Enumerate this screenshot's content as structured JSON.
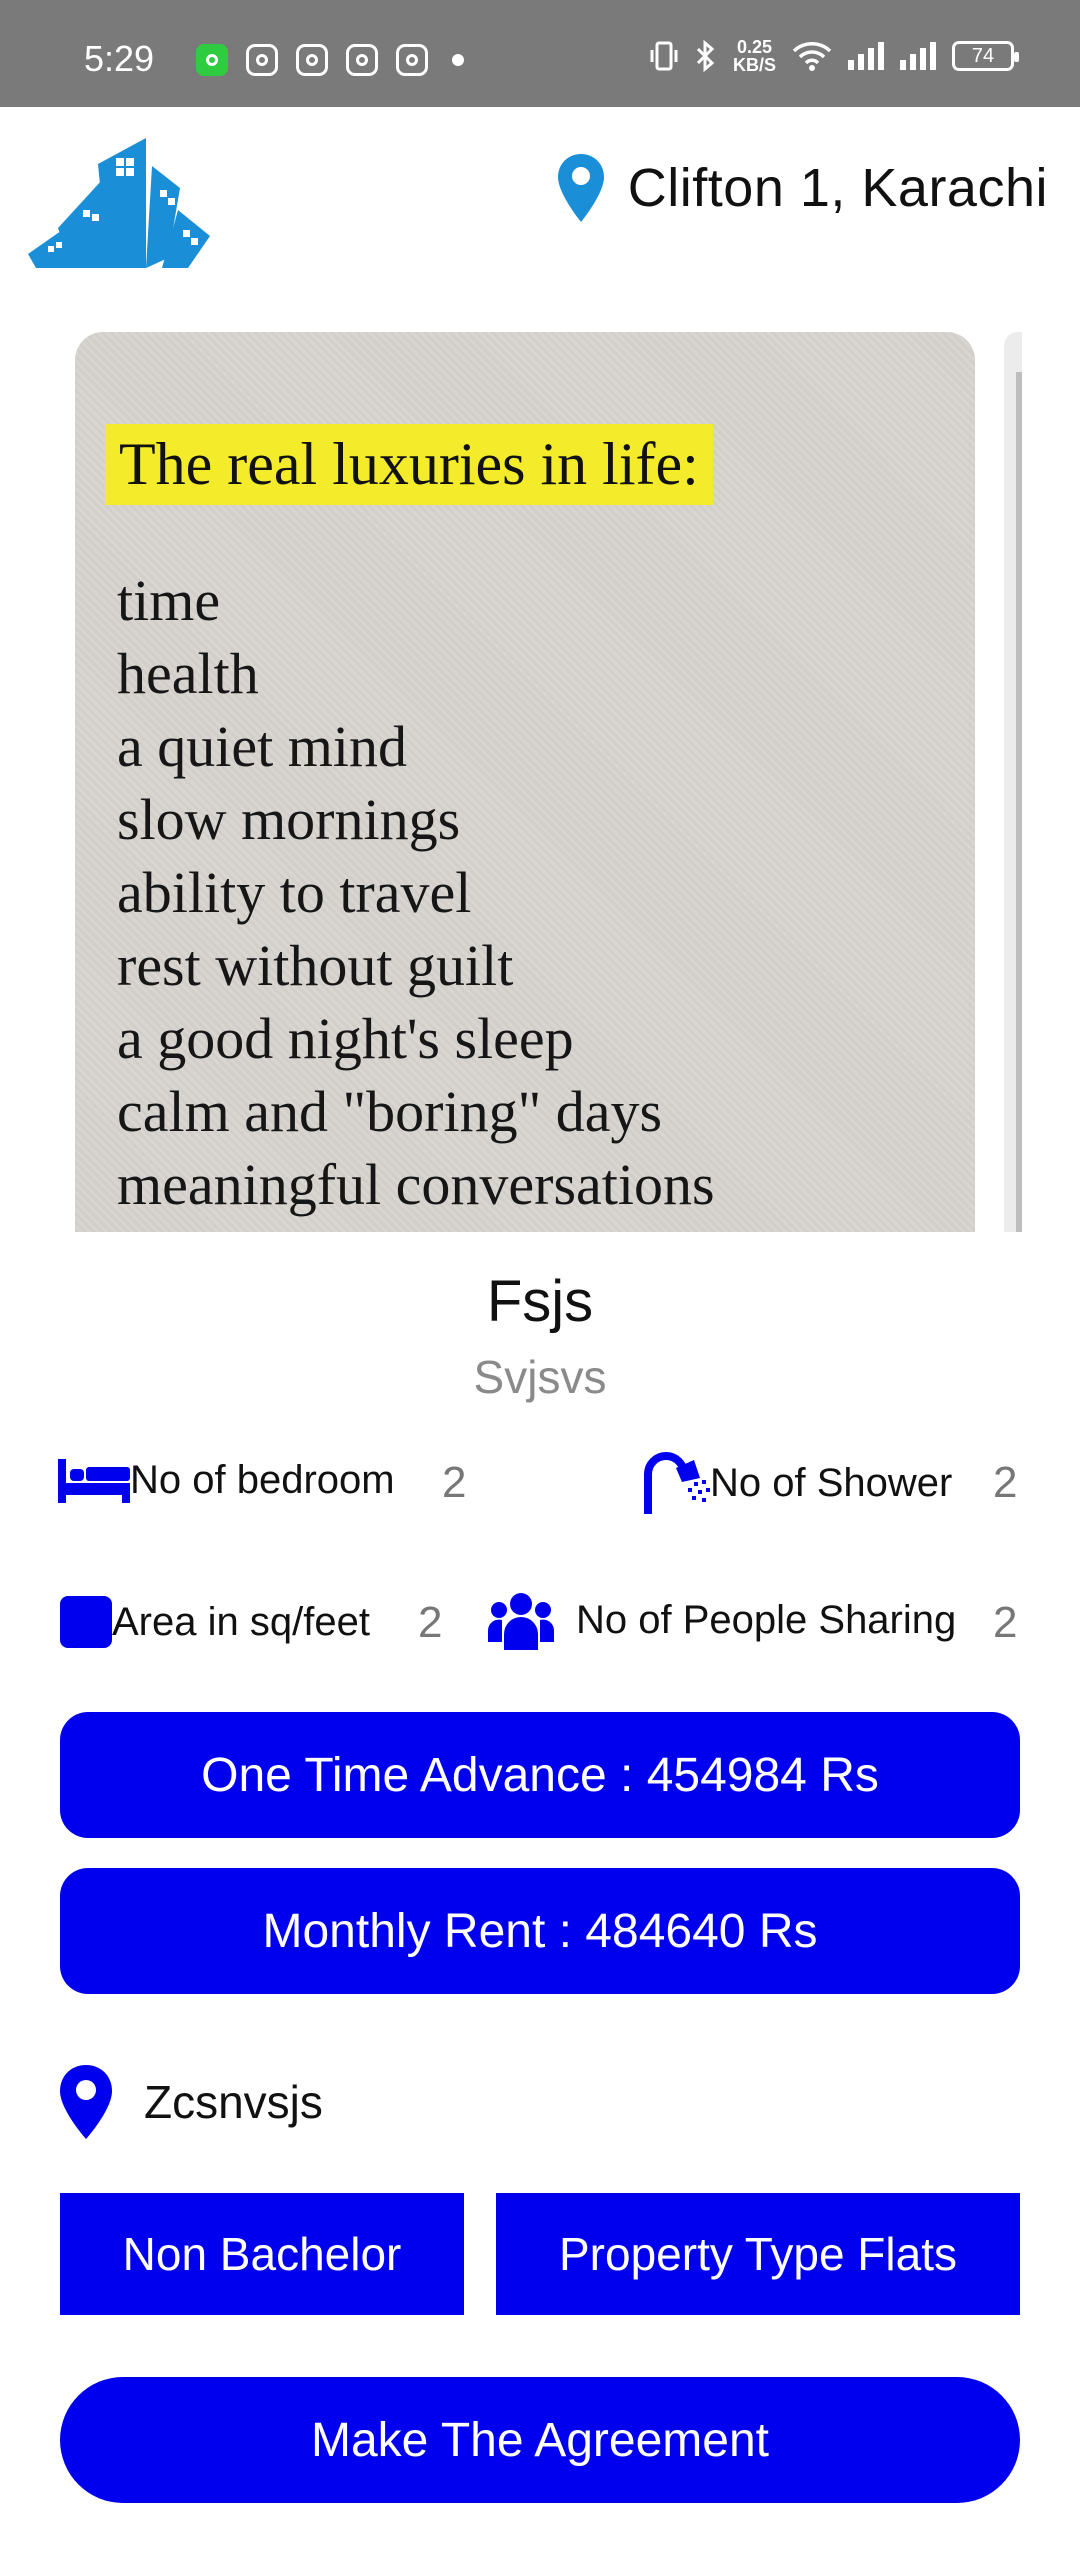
{
  "status_bar": {
    "time": "5:29",
    "speed_value": "0.25",
    "speed_unit": "KB/S",
    "battery": "74"
  },
  "header": {
    "location": "Clifton 1, Karachi",
    "logo_icon": "buildings-logo-icon",
    "location_icon": "map-pin-icon",
    "accent_color": "#1a8fd8"
  },
  "carousel": {
    "quote_title": "The real luxuries in life:",
    "quote_lines": [
      "time",
      "health",
      "a quiet mind",
      "slow mornings",
      "ability to travel",
      "rest without guilt",
      "a good night's sleep",
      "calm and \"boring\" days",
      "meaningful conversations"
    ]
  },
  "property": {
    "title": "Fsjs",
    "subtitle": "Svjsvs",
    "features": [
      {
        "icon": "bed-icon",
        "label": "No of bedroom",
        "value": "2"
      },
      {
        "icon": "shower-icon",
        "label": "No of Shower",
        "value": "2"
      },
      {
        "icon": "area-square-icon",
        "label": "Area in sq/feet",
        "value": "2"
      },
      {
        "icon": "people-group-icon",
        "label": "No of People Sharing",
        "value": "2"
      }
    ],
    "advance_label": "One Time Advance : 454984 Rs",
    "rent_label": "Monthly Rent : 484640 Rs",
    "address": "Zcsnvsjs",
    "tag_bachelor": "Non Bachelor",
    "tag_type": "Property Type Flats",
    "agreement_label": "Make The Agreement",
    "button_color": "#0000ee"
  }
}
